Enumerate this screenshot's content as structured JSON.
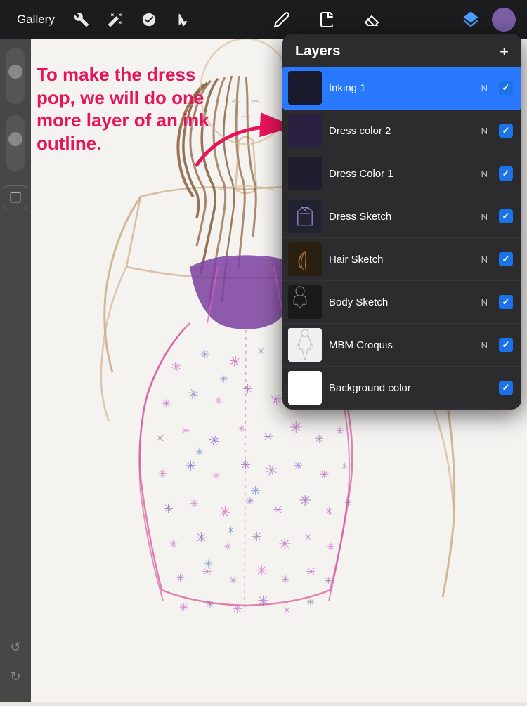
{
  "toolbar": {
    "gallery_label": "Gallery",
    "tools": [
      "wrench",
      "magic",
      "smudge",
      "arrow"
    ],
    "drawing_tools": [
      "pencil",
      "pen",
      "eraser"
    ],
    "layers_label": "Layers",
    "add_label": "+"
  },
  "annotation": {
    "text": "To make the dress pop, we will do one more layer of an ink outline."
  },
  "layers_panel": {
    "title": "Layers",
    "add_btn": "+",
    "items": [
      {
        "id": "inking1",
        "label": "Inking 1",
        "mode": "N",
        "checked": true,
        "active": true,
        "thumb_type": "inking"
      },
      {
        "id": "dresscolor2",
        "label": "Dress color 2",
        "mode": "N",
        "checked": true,
        "active": false,
        "thumb_type": "dresscolor2"
      },
      {
        "id": "dresscolor1",
        "label": "Dress Color 1",
        "mode": "N",
        "checked": true,
        "active": false,
        "thumb_type": "dresscolor1"
      },
      {
        "id": "dresssketch",
        "label": "Dress Sketch",
        "mode": "N",
        "checked": true,
        "active": false,
        "thumb_type": "dresssketch"
      },
      {
        "id": "hairsketch",
        "label": "Hair Sketch",
        "mode": "N",
        "checked": true,
        "active": false,
        "thumb_type": "hairsketch"
      },
      {
        "id": "bodysketch",
        "label": "Body Sketch",
        "mode": "N",
        "checked": true,
        "active": false,
        "thumb_type": "bodysketch"
      },
      {
        "id": "mbmcroquis",
        "label": "MBM Croquis",
        "mode": "N",
        "checked": true,
        "active": false,
        "thumb_type": "croquis"
      },
      {
        "id": "backgroundcolor",
        "label": "Background color",
        "mode": "",
        "checked": true,
        "active": false,
        "thumb_type": "white"
      }
    ]
  },
  "sidebar": {
    "undo_label": "↺",
    "redo_label": "↻"
  },
  "colors": {
    "toolbar_bg": "#1c1c1e",
    "panel_bg": "#2c2c2e",
    "active_layer": "#2979ff",
    "annotation_color": "#e8145a"
  }
}
